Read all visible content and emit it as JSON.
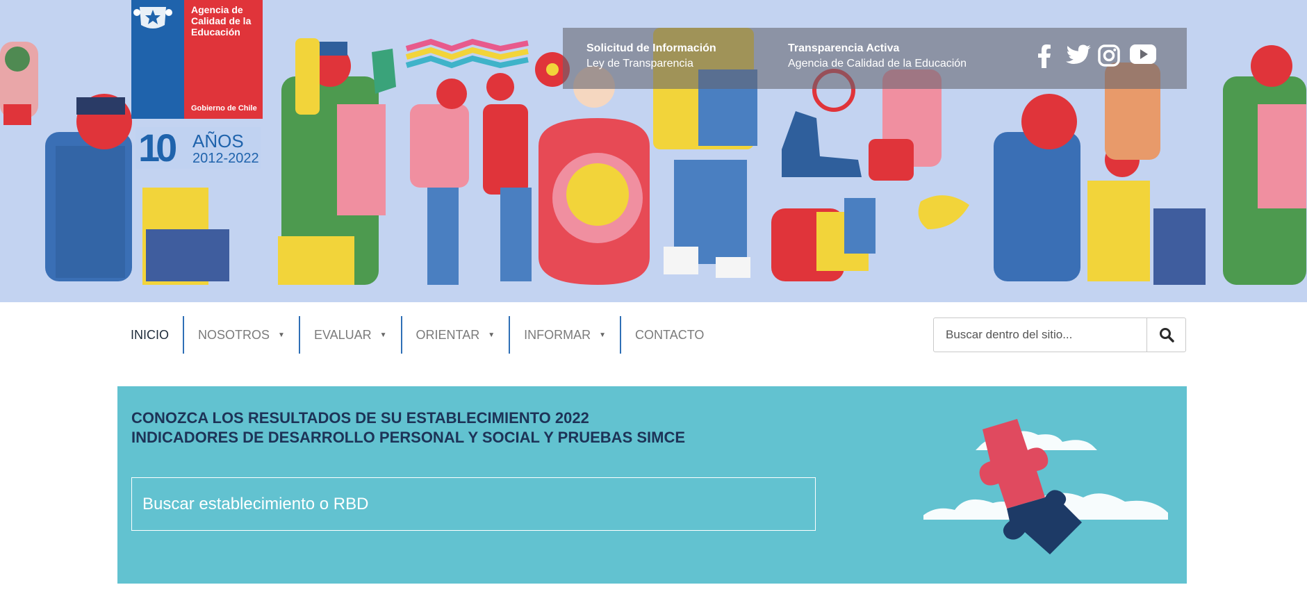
{
  "header": {
    "logo": {
      "org_name": "Agencia de Calidad de la Educación",
      "government": "Gobierno de Chile",
      "seal_icon": "chile-coat-of-arms-icon"
    },
    "anniversary": {
      "number": "10",
      "word": "AÑOS",
      "years": "2012-2022"
    },
    "top_links": [
      {
        "title": "Solicitud de Información",
        "subtitle": "Ley de Transparencia"
      },
      {
        "title": "Transparencia Activa",
        "subtitle": "Agencia de Calidad de la Educación"
      }
    ],
    "social": [
      "facebook-icon",
      "twitter-icon",
      "instagram-icon",
      "youtube-icon"
    ]
  },
  "nav": {
    "items": [
      {
        "label": "INICIO",
        "active": true,
        "dropdown": false
      },
      {
        "label": "NOSOTROS",
        "dropdown": true
      },
      {
        "label": "EVALUAR",
        "dropdown": true
      },
      {
        "label": "ORIENTAR",
        "dropdown": true
      },
      {
        "label": "INFORMAR",
        "dropdown": true
      },
      {
        "label": "CONTACTO",
        "dropdown": false
      }
    ],
    "search": {
      "placeholder": "Buscar dentro del sitio...",
      "icon": "search-icon"
    }
  },
  "banner": {
    "title_line1": "CONOZCA LOS RESULTADOS DE SU ESTABLECIMIENTO 2022",
    "title_line2": "INDICADORES DE DESARROLLO PERSONAL Y SOCIAL Y PRUEBAS SIMCE",
    "search_placeholder": "Buscar establecimiento o RBD",
    "art": "puzzle-pieces-clouds-illustration"
  },
  "colors": {
    "hero_bg": "#c3d3f1",
    "logo_blue": "#1f63ac",
    "logo_red": "#e0343a",
    "nav_divider": "#2f6fb6",
    "banner_bg": "#62c2d0",
    "banner_title": "#1d3357",
    "puzzle_red": "#e04a5f",
    "puzzle_navy": "#1d3a66"
  }
}
